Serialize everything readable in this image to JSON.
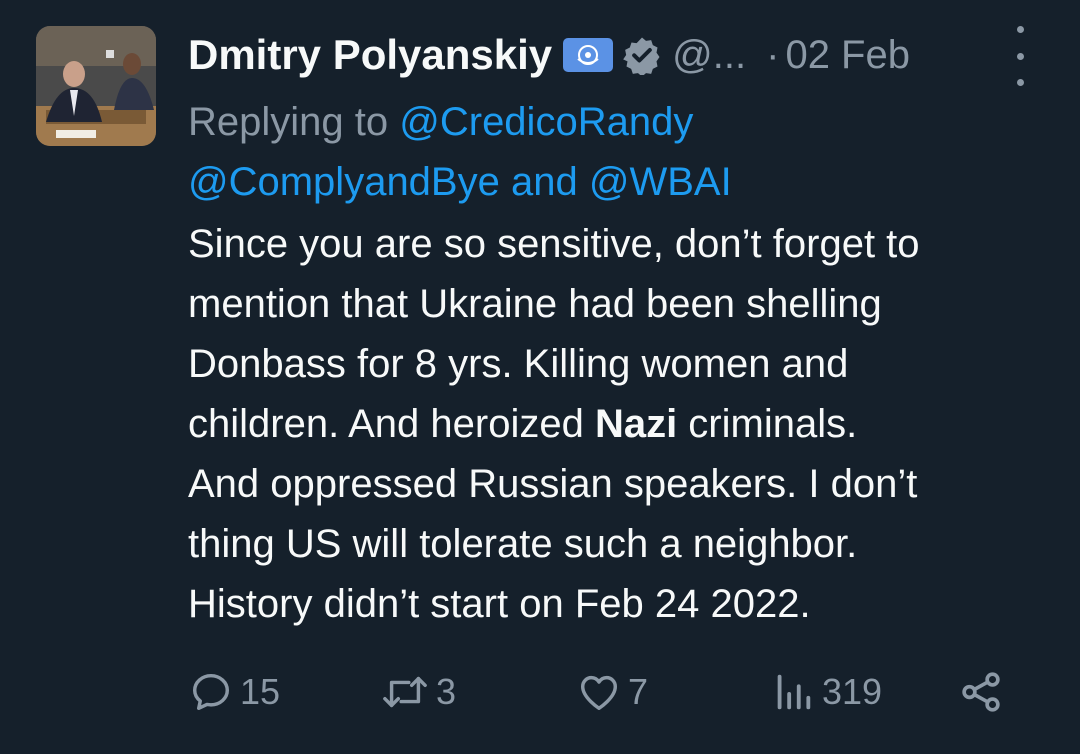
{
  "tweet": {
    "author_name": "Dmitry Polyanskiy",
    "handle": "@...",
    "separator": "·",
    "date": "02 Feb",
    "replying_prefix": "Replying to",
    "replying_mentions": [
      "@CredicoRandy",
      "@ComplyandBye",
      "@WBAI"
    ],
    "replying_and": "and",
    "body_lines": [
      "Since you are so sensitive, don’t forget to",
      "mention that Ukraine had been shelling",
      "Donbass for 8 yrs. Killing women and",
      "children. And heroized ",
      " criminals.",
      "And oppressed Russian speakers. I don’t",
      "thing US will tolerate such a neighbor.",
      "History didn’t start on Feb 24 2022."
    ],
    "bold_word": "Nazi"
  },
  "actions": {
    "replies": "15",
    "retweets": "3",
    "likes": "7",
    "views": "319"
  },
  "icons": {
    "flag": "un-flag-icon",
    "verified": "verified-badge-icon",
    "more": "more-vertical-icon",
    "reply": "reply-bubble-icon",
    "retweet": "retweet-icon",
    "like": "heart-icon",
    "views": "views-bar-icon",
    "share": "share-icon"
  },
  "colors": {
    "background": "#15202b",
    "text": "#f7f9f9",
    "muted": "#8b98a5",
    "link": "#1d9bf0",
    "flag_blue": "#5b92e5"
  }
}
